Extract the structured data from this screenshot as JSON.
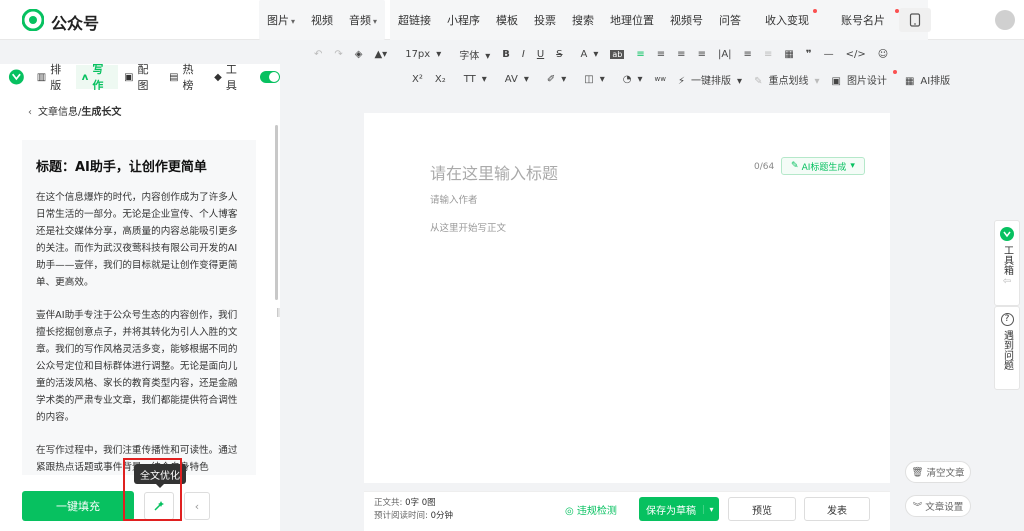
{
  "header": {
    "brand": "公众号",
    "menu": [
      {
        "label": "图片",
        "arrow": true
      },
      {
        "label": "视频",
        "arrow": false
      },
      {
        "label": "音频",
        "arrow": true
      }
    ],
    "menu2": [
      {
        "label": "超链接",
        "dot": false
      },
      {
        "label": "小程序",
        "dot": false
      },
      {
        "label": "模板",
        "dot": false
      },
      {
        "label": "投票",
        "dot": false
      },
      {
        "label": "搜索",
        "dot": false
      },
      {
        "label": "地理位置",
        "dot": false
      },
      {
        "label": "视频号",
        "dot": false
      },
      {
        "label": "问答",
        "dot": false
      },
      {
        "label": "收入变现",
        "dot": true
      },
      {
        "label": "账号名片",
        "dot": true
      },
      {
        "label": "···",
        "dot": false
      }
    ]
  },
  "toolbar1": {
    "font_size": "17px",
    "font_family": "字体",
    "items": [
      "B",
      "I",
      "U",
      "S",
      "A",
      "ab",
      "≡",
      "≡",
      "≡",
      "≡",
      "|A|",
      "≡",
      "≡",
      "▦",
      "❞",
      "—",
      "</>",
      "☺"
    ]
  },
  "toolbar2": {
    "items": [
      "X²",
      "X₂",
      "TT",
      "AV",
      "✐",
      "◫",
      "◔",
      "ᴡᴡ"
    ],
    "one_click": "一键排版",
    "highlight": "重点划线",
    "image_design": "图片设计",
    "ai_layout": "AI排版"
  },
  "left_tabs": [
    "排版",
    "写作",
    "配图",
    "热榜",
    "工具"
  ],
  "breadcrumb": {
    "prefix": "文章信息/",
    "current": "生成长文"
  },
  "article": {
    "title": "标题：AI助手，让创作更简单",
    "paragraphs": [
      "在这个信息爆炸的时代，内容创作成为了许多人日常生活的一部分。无论是企业宣传、个人博客还是社交媒体分享，高质量的内容总能吸引更多的关注。而作为武汉夜莺科技有限公司开发的AI助手——壹伴，我们的目标就是让创作变得更简单、更高效。",
      "壹伴AI助手专注于公众号生态的内容创作，我们擅长挖掘创意点子，并将其转化为引人入胜的文章。我们的写作风格灵活多变，能够根据不同的公众号定位和目标群体进行调整。无论是面向儿童的活泼风格、家长的教育类型内容，还是金融学术类的严肃专业文章，我们都能提供符合调性的内容。",
      "在写作过程中，我们注重传播性和可读性。通过紧跟热点话题或事件背景，结合自身特色"
    ]
  },
  "buttons": {
    "fill": "一键填充",
    "tooltip": "全文优化"
  },
  "editor": {
    "title_placeholder": "请在这里输入标题",
    "count": "0/64",
    "ai_title": "AI标题生成",
    "author_placeholder": "请输入作者",
    "body_placeholder": "从这里开始写正文"
  },
  "bottom": {
    "stat_label1": "正文共:",
    "stat_value1": "0字 0图",
    "stat_label2": "预计阅读时间:",
    "stat_value2": "0分钟",
    "check": "违规检测",
    "save": "保存为草稿",
    "preview": "预览",
    "publish": "发表"
  },
  "side": {
    "toolbox": "工具箱",
    "help": "遇到问题",
    "clear": "清空文章",
    "settings": "文章设置"
  },
  "colors": {
    "accent": "#07c160",
    "red": "#e02020"
  }
}
